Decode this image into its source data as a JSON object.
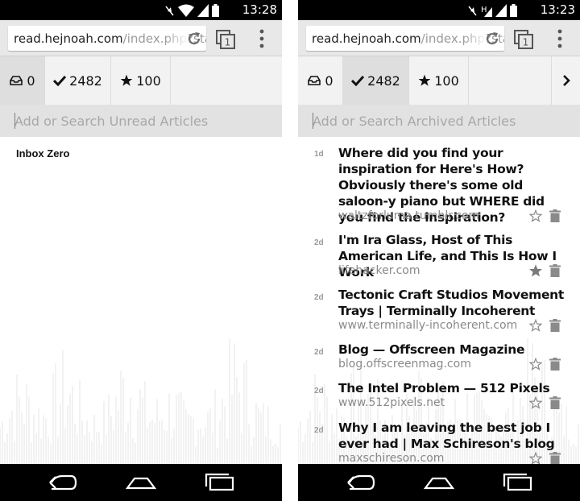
{
  "colors": {
    "status_bar": "#000000",
    "address_bar": "#e8e8e8",
    "tab_bar": "#f2f2f2",
    "active_tab": "#dedede",
    "search_bar": "#e2e2e2",
    "title_text": "#111111",
    "muted_text": "#8a8a8a",
    "waveform": "#ececec"
  },
  "left": {
    "status": {
      "time": "13:28",
      "icons": [
        "muted-icon",
        "wifi-icon",
        "signal-icon",
        "battery-icon"
      ]
    },
    "browser": {
      "url_domain": "read.hejnoah.com",
      "url_path": "/index.php?sta",
      "icons": [
        "reload-icon",
        "tabs-icon",
        "menu-icon"
      ],
      "tab_count": "1"
    },
    "tabs": [
      {
        "icon": "inbox-icon",
        "count": "0",
        "active": true
      },
      {
        "icon": "check-icon",
        "count": "2482",
        "active": false
      },
      {
        "icon": "star-icon",
        "count": "100",
        "active": false
      }
    ],
    "search": {
      "placeholder": "Add or Search Unread Articles"
    },
    "empty_message": "Inbox Zero"
  },
  "right": {
    "status": {
      "time": "13:23",
      "icons": [
        "muted-icon",
        "signal-h-icon",
        "signal-icon",
        "battery-icon"
      ]
    },
    "browser": {
      "url_domain": "read.hejnoah.com",
      "url_path": "/index.php?sta",
      "icons": [
        "reload-icon",
        "tabs-icon",
        "menu-icon"
      ],
      "tab_count": "1"
    },
    "tabs": [
      {
        "icon": "inbox-icon",
        "count": "0",
        "active": false
      },
      {
        "icon": "check-icon",
        "count": "2482",
        "active": true
      },
      {
        "icon": "star-icon",
        "count": "100",
        "active": false
      }
    ],
    "next_icon": "chevron-right-icon",
    "search": {
      "placeholder": "Add or Search Archived Articles"
    },
    "articles": [
      {
        "age": "1d",
        "title": "Where did you find your inspiration for Here's How? Obviously there's some old saloon-y piano but WHERE did you find the inspiration?",
        "domain": "waltzforluma.tumblr.com",
        "starred": false
      },
      {
        "age": "2d",
        "title": "I'm Ira Glass, Host of This American Life, and This Is How I Work",
        "domain": "lifehacker.com",
        "starred": true
      },
      {
        "age": "2d",
        "title": "Tectonic Craft Studios Movement Trays | Terminally Incoherent",
        "domain": "www.terminally-incoherent.com",
        "starred": false
      },
      {
        "age": "2d",
        "title": "Blog — Offscreen Magazine",
        "domain": "blog.offscreenmag.com",
        "starred": false
      },
      {
        "age": "2d",
        "title": "The Intel Problem — 512 Pixels",
        "domain": "www.512pixels.net",
        "starred": false
      },
      {
        "age": "2d",
        "title": "Why I am leaving the best job I ever had | Max Schireson's blog",
        "domain": "maxschireson.com",
        "starred": false
      }
    ]
  },
  "nav_icons": [
    "back-icon",
    "home-icon",
    "recent-apps-icon"
  ]
}
